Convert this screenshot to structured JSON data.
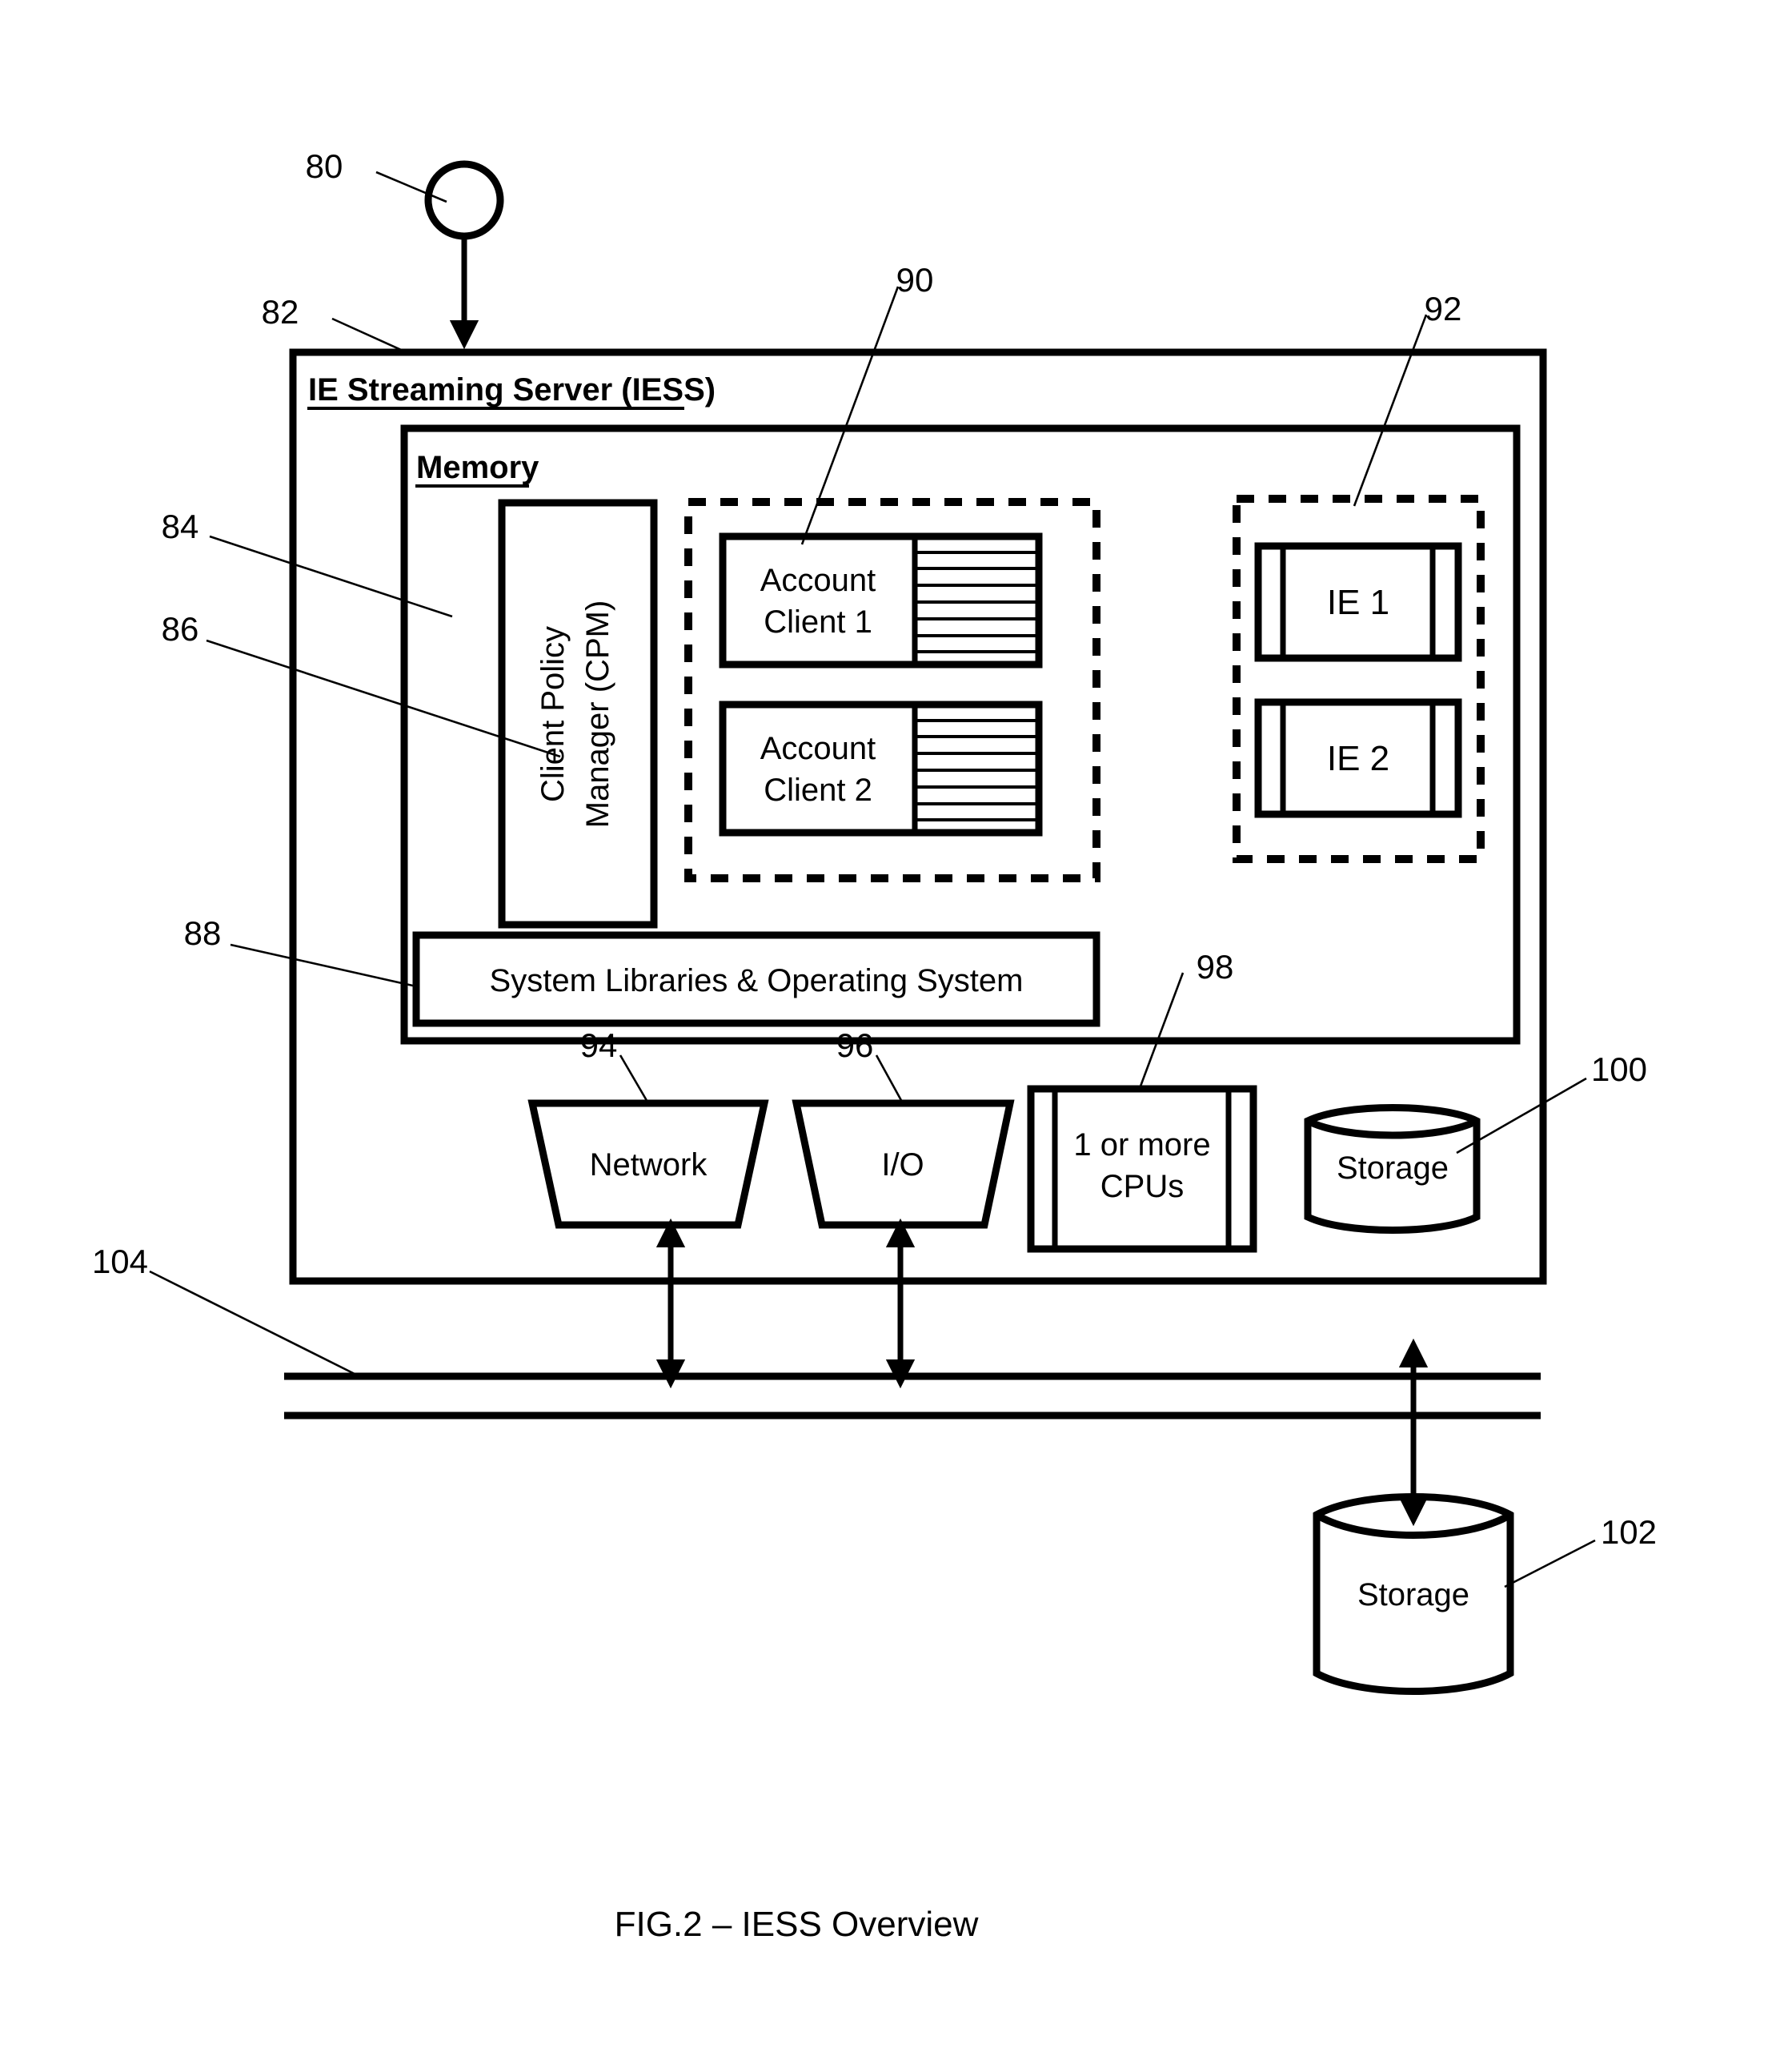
{
  "figure": {
    "caption": "FIG.2  – IESS Overview",
    "type": "patent-block-diagram"
  },
  "server": {
    "title": "IE Streaming Server (IESS)",
    "ref": "82"
  },
  "entry_node": {
    "ref": "80",
    "icon": "circle-node-icon"
  },
  "memory": {
    "title": "Memory",
    "ref": "84"
  },
  "cpm": {
    "line1": "Client Policy",
    "line2": "Manager (CPM)",
    "ref": "86"
  },
  "system_libraries": {
    "label": "System Libraries & Operating System",
    "ref": "88"
  },
  "account_group": {
    "ref": "90",
    "clients": [
      {
        "line1": "Account",
        "line2": "Client 1",
        "stripes": 7
      },
      {
        "line1": "Account",
        "line2": "Client 2",
        "stripes": 7
      }
    ]
  },
  "ie_group": {
    "ref": "92",
    "engines": [
      {
        "label": "IE 1"
      },
      {
        "label": "IE 2"
      }
    ]
  },
  "network": {
    "label": "Network",
    "ref": "94"
  },
  "io": {
    "label": "I/O",
    "ref": "96"
  },
  "cpus": {
    "line1": "1 or more",
    "line2": "CPUs",
    "ref": "98"
  },
  "internal_storage": {
    "label": "Storage",
    "ref": "100"
  },
  "external_storage": {
    "label": "Storage",
    "ref": "102"
  },
  "bus": {
    "ref": "104"
  },
  "colors": {
    "ink": "#000000",
    "paper": "#ffffff"
  }
}
